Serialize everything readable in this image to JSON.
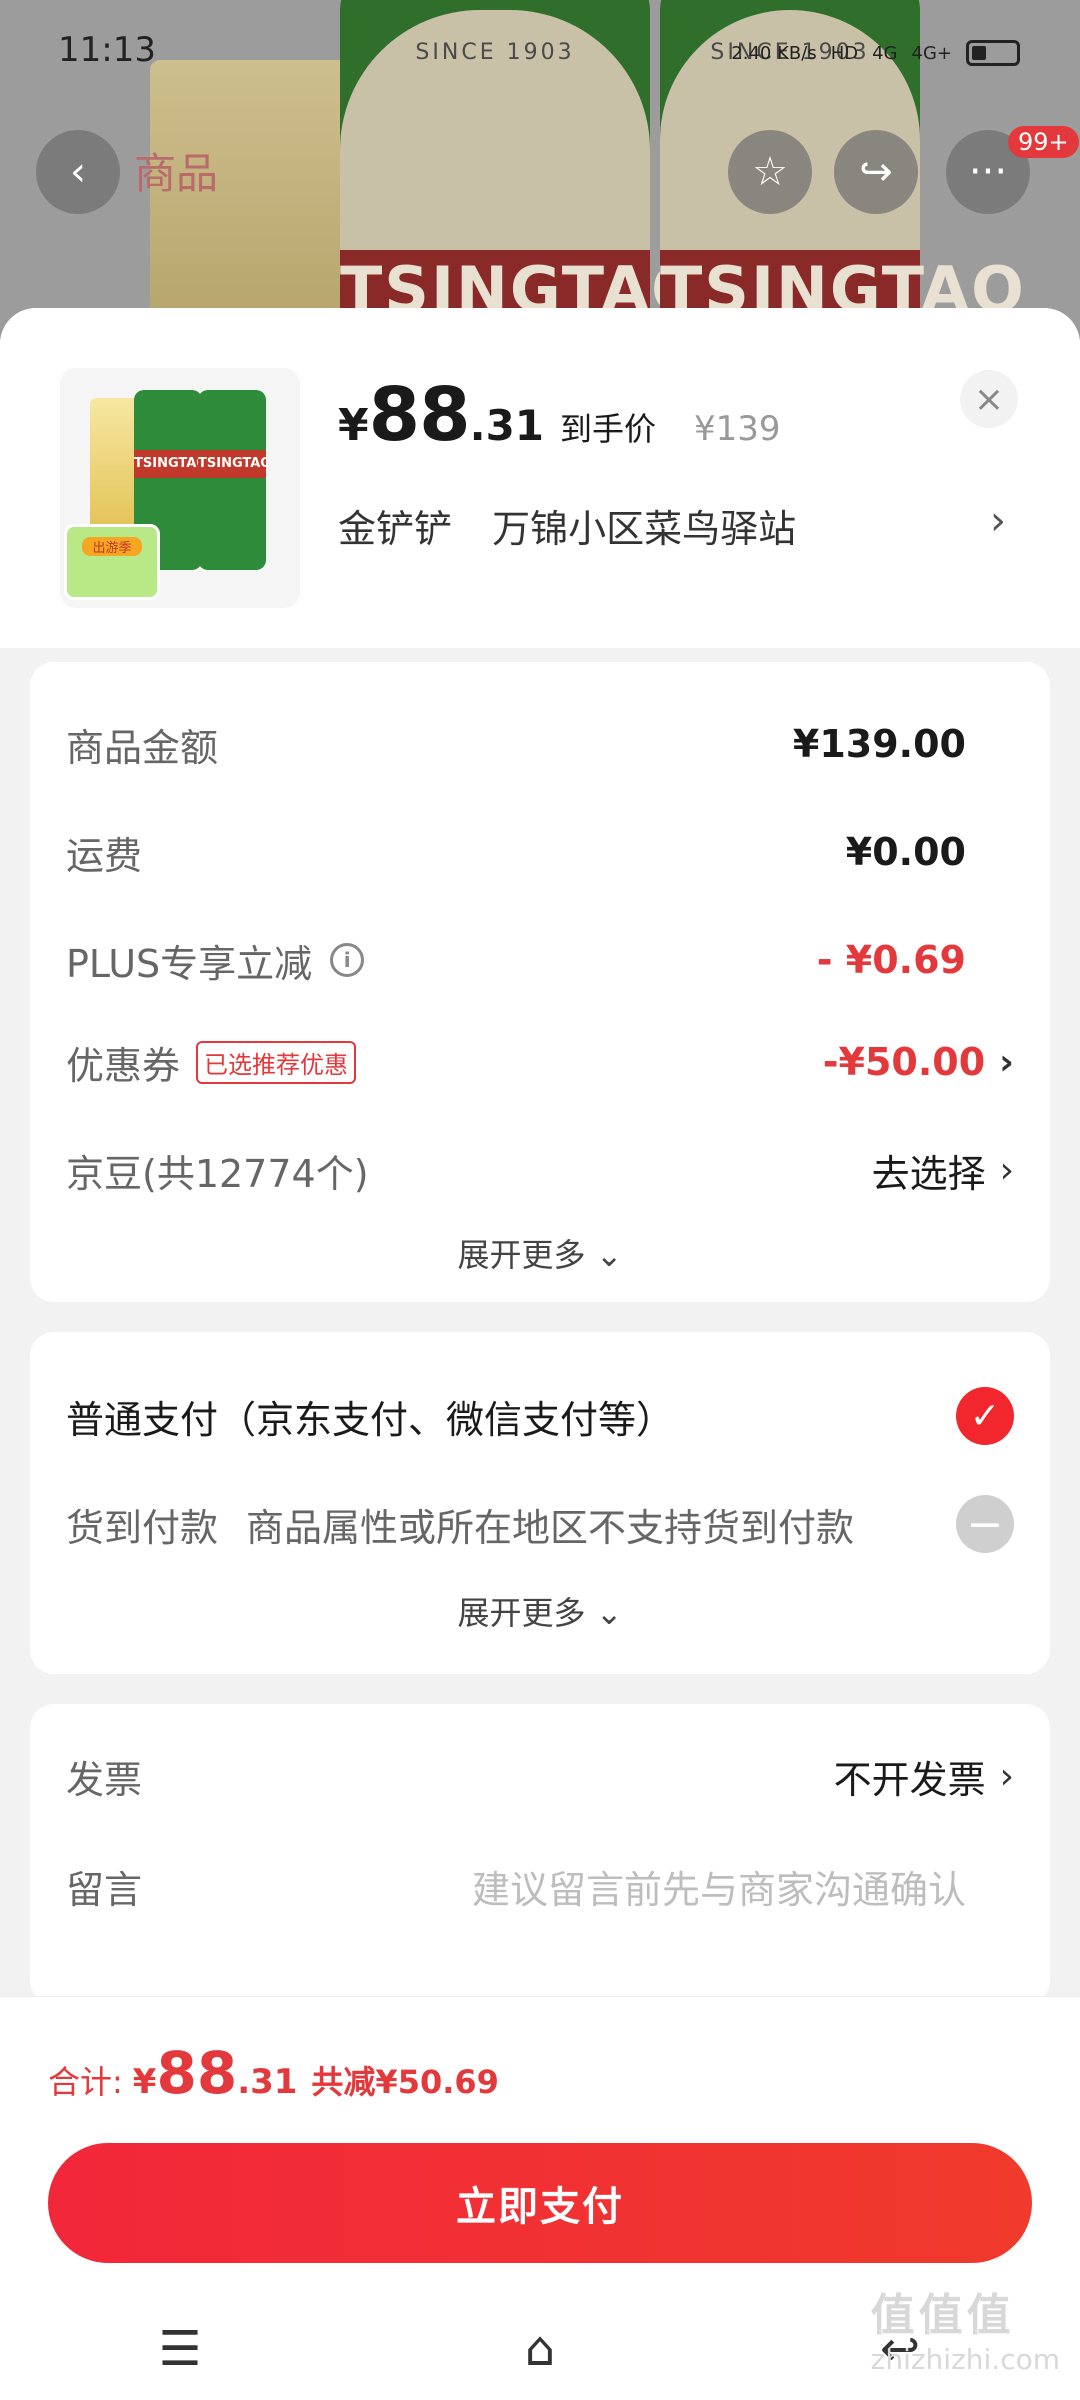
{
  "status_bar": {
    "time": "11:13",
    "net_speed": "2.40 KB/s",
    "hd": "HD",
    "signal1": "4G",
    "signal2": "4G+"
  },
  "bg_page": {
    "title": "商品",
    "badge": "99+",
    "can_year": "SINCE 1903",
    "can_brand": "TSINGTAO"
  },
  "product": {
    "currency": "¥",
    "price_int": "88",
    "price_dec": ".31",
    "price_label": "到手价",
    "orig_price": "¥139",
    "close_icon": "×",
    "buyer": "金铲铲",
    "address": "万锦小区菜鸟驿站",
    "thumb_brand": "TSINGTAO",
    "thumb_tag": "出游季"
  },
  "summary": {
    "goods_label": "商品金额",
    "goods_value": "¥139.00",
    "shipping_label": "运费",
    "shipping_value": "¥0.00",
    "plus_label": "PLUS专享立减",
    "plus_value": "- ¥0.69",
    "coupon_label": "优惠券",
    "coupon_tag": "已选推荐优惠",
    "coupon_value": "-¥50.00",
    "beans_label": "京豆(共12774个)",
    "beans_value": "去选择",
    "expand": "展开更多"
  },
  "payment": {
    "normal_label": "普通支付（京东支付、微信支付等）",
    "cod_label": "货到付款",
    "cod_note": "商品属性或所在地区不支持货到付款",
    "expand": "展开更多"
  },
  "extra": {
    "invoice_label": "发票",
    "invoice_value": "不开发票",
    "remark_label": "留言",
    "remark_placeholder": "建议留言前先与商家沟通确认"
  },
  "footer": {
    "total_label": "合计:",
    "total_cur": "¥",
    "total_int": "88",
    "total_dec": ".31",
    "total_save": "共减¥50.69",
    "pay_button": "立即支付"
  },
  "watermark": {
    "main": "值值值",
    "sub": "zhizhizhi.com"
  },
  "colors": {
    "accent": "#e4393c",
    "button": "#f2273a"
  }
}
